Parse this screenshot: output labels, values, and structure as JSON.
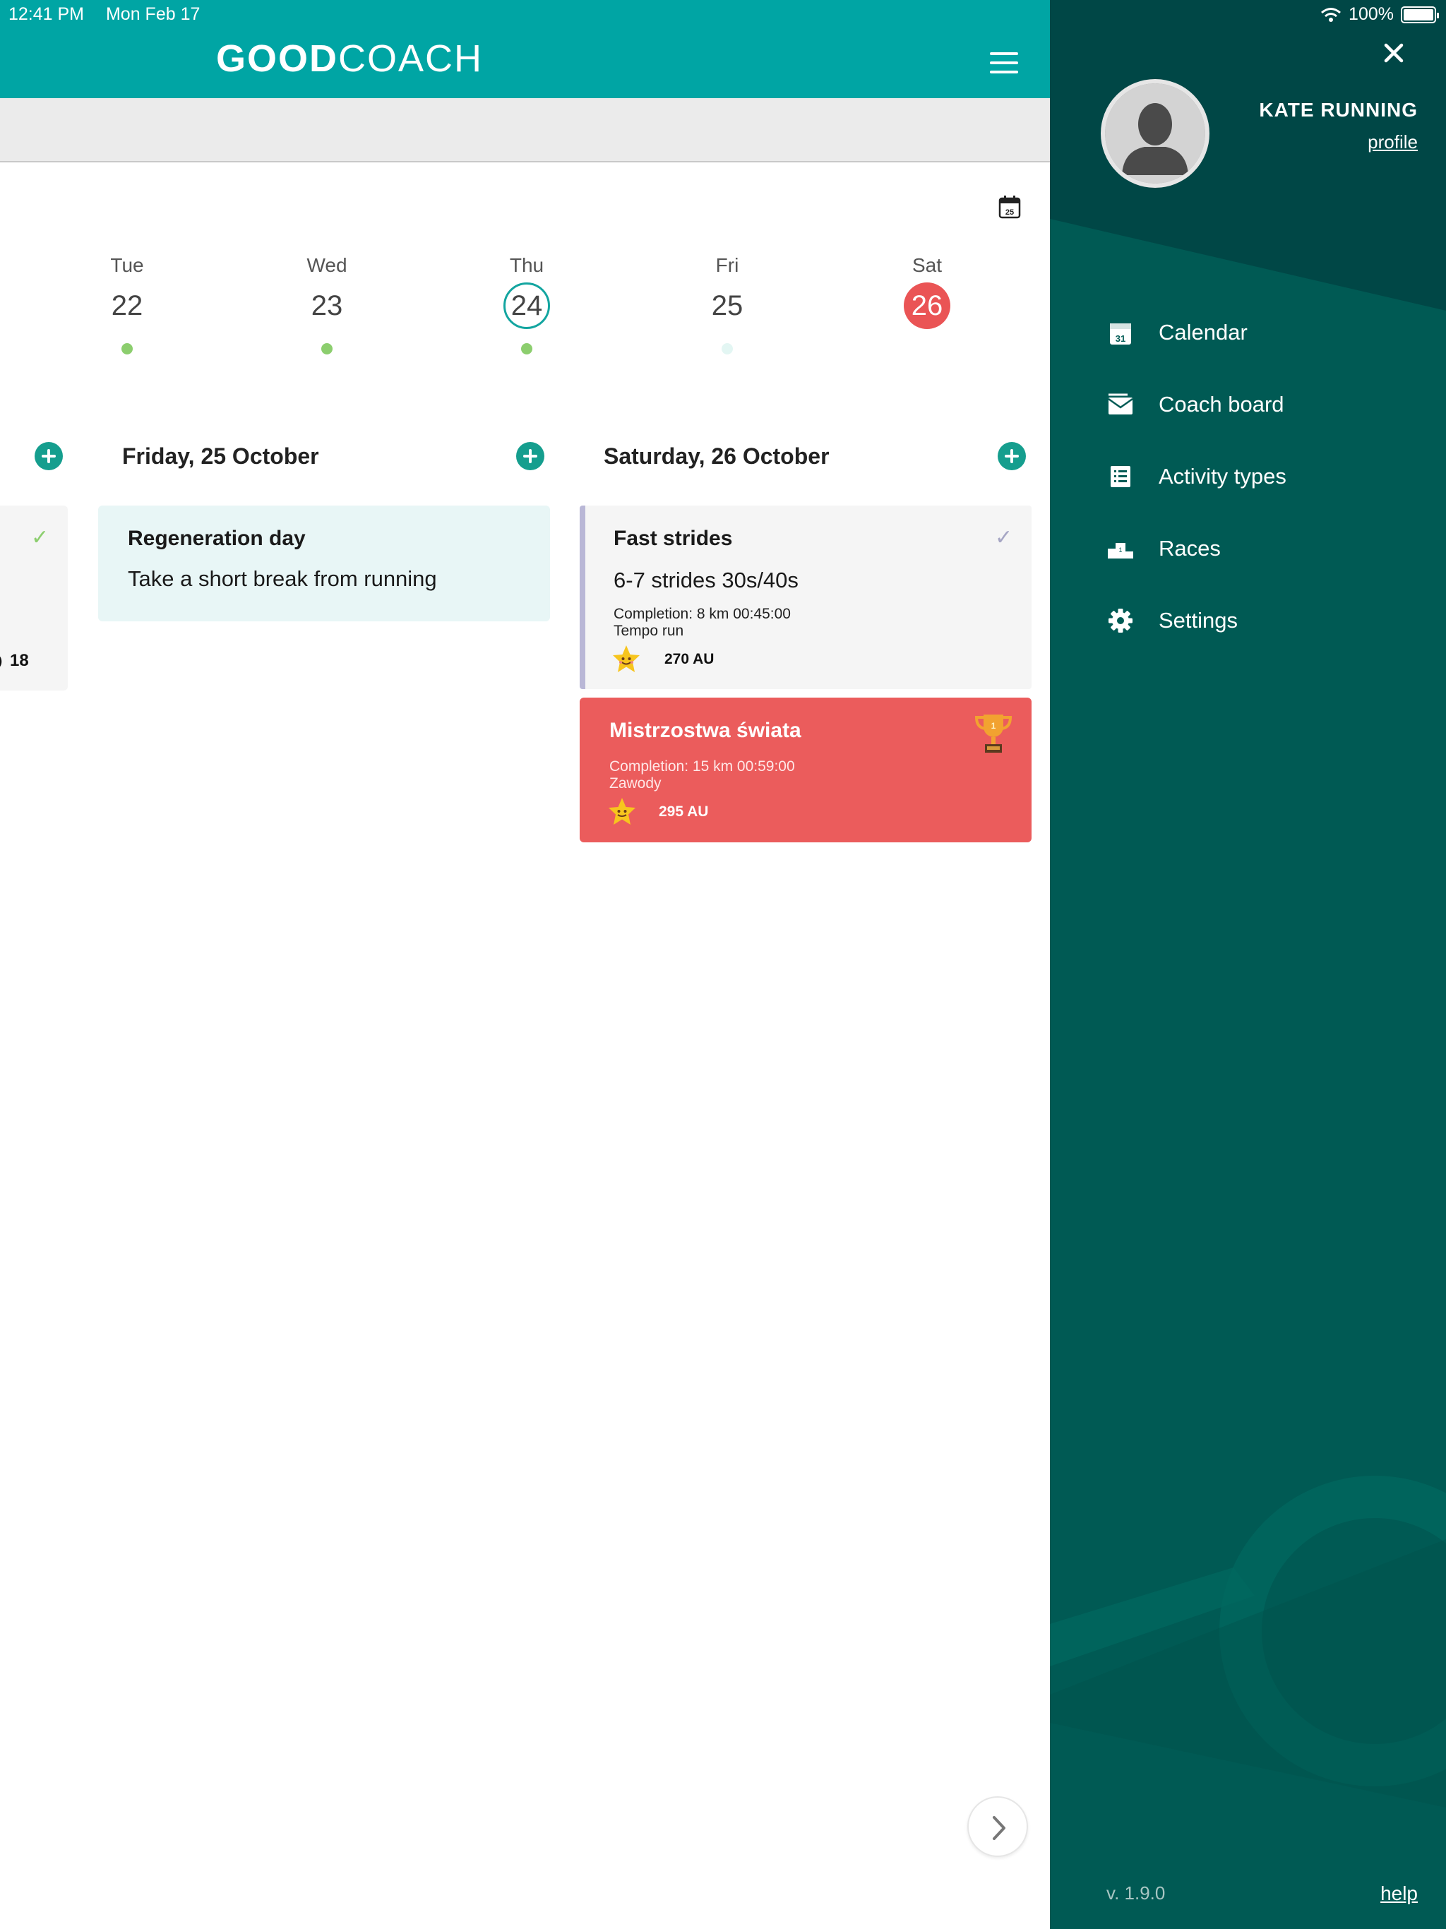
{
  "status_bar": {
    "time": "12:41 PM",
    "date": "Mon Feb 17",
    "battery": "100%"
  },
  "header": {
    "logo_bold": "GOOD",
    "logo_light": "COACH"
  },
  "week": {
    "days": [
      {
        "name": "Tue",
        "num": "22"
      },
      {
        "name": "Wed",
        "num": "23"
      },
      {
        "name": "Thu",
        "num": "24"
      },
      {
        "name": "Fri",
        "num": "25"
      },
      {
        "name": "Sat",
        "num": "26"
      }
    ]
  },
  "columns": {
    "friday": {
      "title": "Friday, 25 October"
    },
    "saturday": {
      "title": "Saturday, 26 October"
    }
  },
  "partial_card": {
    "load": "18"
  },
  "regen_card": {
    "title": "Regeneration day",
    "desc": "Take a short break from running"
  },
  "strides_card": {
    "title": "Fast strides",
    "desc": "6-7 strides 30s/40s",
    "completion": "Completion: 8 km 00:45:00",
    "type": "Tempo run",
    "load": "270 AU"
  },
  "race_card": {
    "title": "Mistrzostwa świata",
    "completion": "Completion: 15 km 00:59:00",
    "type": "Zawody",
    "load": "295 AU"
  },
  "drawer": {
    "user_name": "KATE RUNNING",
    "profile_link": "profile",
    "menu": [
      {
        "label": "Calendar",
        "icon": "calendar-icon"
      },
      {
        "label": "Coach board",
        "icon": "envelope-icon"
      },
      {
        "label": "Activity types",
        "icon": "list-icon"
      },
      {
        "label": "Races",
        "icon": "podium-icon"
      },
      {
        "label": "Settings",
        "icon": "gear-icon"
      }
    ],
    "version": "v. 1.9.0",
    "help": "help"
  },
  "colors": {
    "header": "#00a5a4",
    "drawer": "#005a54",
    "accent_red": "#eb5c5c",
    "add_button": "#159e8e"
  }
}
